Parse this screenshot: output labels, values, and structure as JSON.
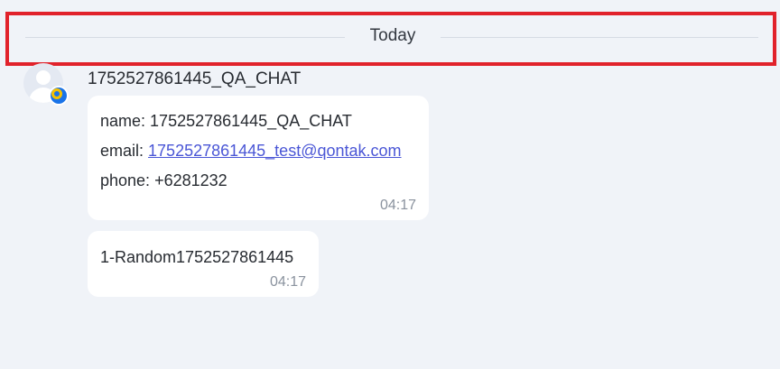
{
  "divider": {
    "label": "Today"
  },
  "sender": {
    "name": "1752527861445_QA_CHAT",
    "avatar_icon": "user-avatar-icon",
    "channel_icon": "qontak-channel-icon"
  },
  "messages": [
    {
      "name_label": "name:",
      "name_value": "1752527861445_QA_CHAT",
      "email_label": "email:",
      "email_value": "1752527861445_test@qontak.com",
      "phone_label": "phone:",
      "phone_value": "+6281232",
      "time": "04:17"
    },
    {
      "text": "1-Random1752527861445",
      "time": "04:17"
    }
  ],
  "colors": {
    "highlight": "#e1222b",
    "link": "#4a56d6",
    "background": "#f0f3f8"
  }
}
